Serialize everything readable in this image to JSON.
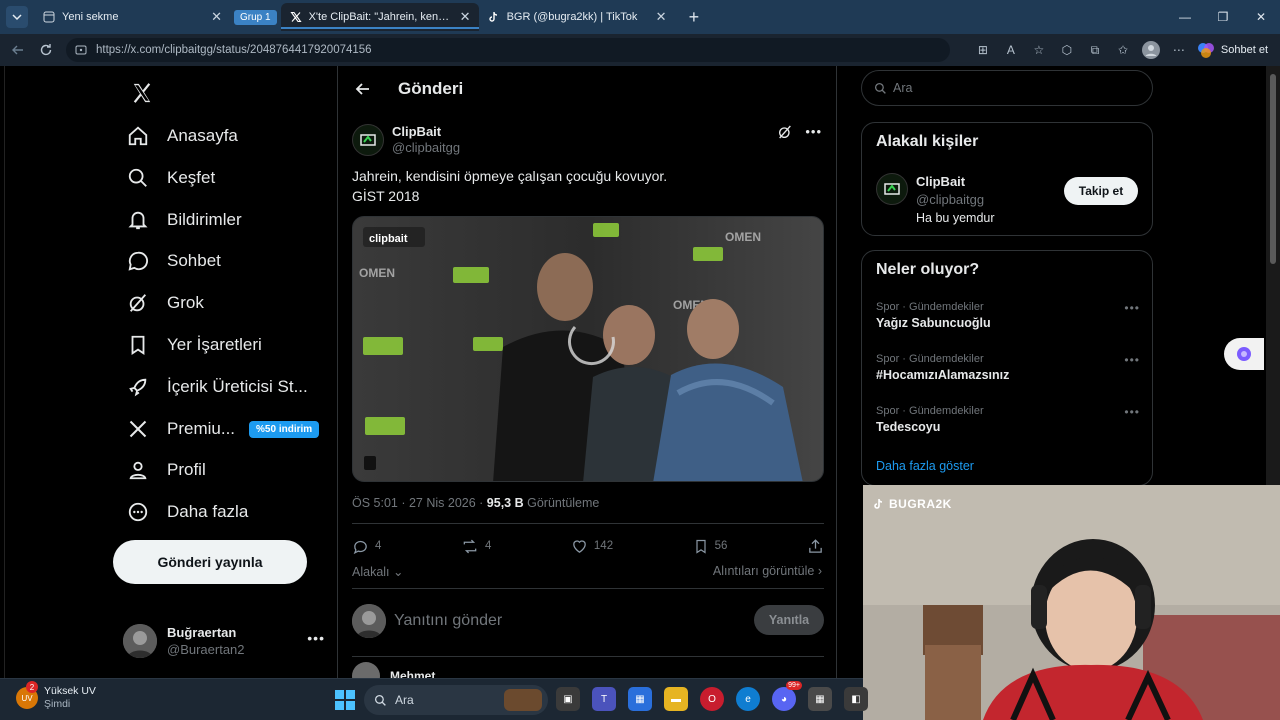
{
  "browser": {
    "tabs": [
      {
        "title": "Yeni sekme"
      },
      {
        "title": "X'te ClipBait: \"Jahrein, kendisini öp"
      },
      {
        "title": "BGR (@bugra2kk) | TikTok"
      }
    ],
    "group_label": "Grup 1",
    "url": "https://x.com/clipbaitgg/status/2048764417920074156",
    "copilot_label": "Sohbet et"
  },
  "nav": {
    "items": [
      {
        "label": "Anasayfa",
        "icon": "home-icon"
      },
      {
        "label": "Keşfet",
        "icon": "search-icon"
      },
      {
        "label": "Bildirimler",
        "icon": "bell-icon"
      },
      {
        "label": "Sohbet",
        "icon": "chat-icon"
      },
      {
        "label": "Grok",
        "icon": "grok-icon"
      },
      {
        "label": "Yer İşaretleri",
        "icon": "bookmark-icon"
      },
      {
        "label": "İçerik Üreticisi St...",
        "icon": "rocket-icon"
      },
      {
        "label": "Premiu...",
        "icon": "x-icon"
      },
      {
        "label": "Profil",
        "icon": "person-icon"
      },
      {
        "label": "Daha fazla",
        "icon": "more-circle-icon"
      }
    ],
    "premium_badge": "%50 indirim",
    "post_button": "Gönderi yayınla",
    "account": {
      "name": "Buğraertan",
      "handle": "@Buraertan2"
    }
  },
  "post": {
    "header_title": "Gönderi",
    "author_name": "ClipBait",
    "author_handle": "@clipbaitgg",
    "text_line1": "Jahrein, kendisini öpmeye çalışan çocuğu kovuyor.",
    "text_line2": "GİST 2018",
    "video_watermark": "clipbait",
    "meta_time": "ÖS 5:01 · 27 Nis 2026 · ",
    "views": "95,3 B",
    "views_label": " Görüntüleme",
    "replies": "4",
    "reposts": "4",
    "likes": "142",
    "bookmarks": "56",
    "relevance": "Alakalı",
    "quotes_link": "Alıntıları görüntüle",
    "reply_placeholder": "Yanıtını gönder",
    "reply_button": "Yanıtla",
    "next_reply_name": "Mehmet"
  },
  "right": {
    "search_placeholder": "Ara",
    "related_title": "Alakalı kişiler",
    "related_person": {
      "name": "ClipBait",
      "handle": "@clipbaitgg",
      "bio": "Ha bu yemdur"
    },
    "follow_button": "Takip et",
    "trends_title": "Neler oluyor?",
    "trends": [
      {
        "category": "Spor · Gündemdekiler",
        "name": "Yağız Sabuncuoğlu"
      },
      {
        "category": "Spor · Gündemdekiler",
        "name": "#HocamızıAlamazsınız"
      },
      {
        "category": "Spor · Gündemdekiler",
        "name": "Tedescoyu"
      }
    ],
    "show_more": "Daha fazla göster"
  },
  "webcam": {
    "tag": "BUGRA2K"
  },
  "taskbar": {
    "weather_title": "Yüksek UV",
    "weather_sub": "Şimdi",
    "weather_badge": "2",
    "search_placeholder": "Ara",
    "discord_badge": "99+"
  },
  "colors": {
    "accent": "#1d9bf0",
    "background": "#000000",
    "clipbait_green": "#39d353"
  }
}
